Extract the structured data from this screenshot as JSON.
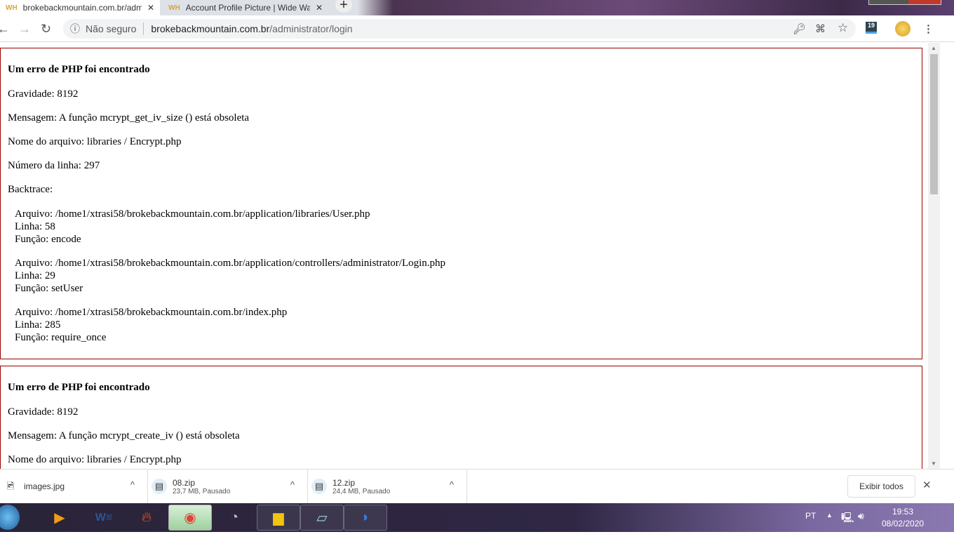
{
  "browser": {
    "tabs": [
      {
        "favicon": "WH",
        "title": "brokebackmountain.com.br/adm",
        "active": true
      },
      {
        "favicon": "WH",
        "title": "Account Profile Picture | Wide Wa",
        "active": false
      }
    ],
    "new_tab": "+",
    "close_glyph": "✕",
    "security_label": "Não seguro",
    "url_host": "brokebackmountain.com.br",
    "url_path": "/administrator/login",
    "calendar_badge": "19"
  },
  "errors": [
    {
      "heading": "Um erro de PHP foi encontrado",
      "severity": "Gravidade: 8192",
      "message": "Mensagem: A função mcrypt_get_iv_size () está obsoleta",
      "filename": "Nome do arquivo: libraries / Encrypt.php",
      "line": "Número da linha: 297",
      "backtrace_label": "Backtrace:",
      "backtrace": [
        {
          "file": "Arquivo: /home1/xtrasi58/brokebackmountain.com.br/application/libraries/User.php",
          "line": "Linha: 58",
          "func": "Função: encode"
        },
        {
          "file": "Arquivo: /home1/xtrasi58/brokebackmountain.com.br/application/controllers/administrator/Login.php",
          "line": "Linha: 29",
          "func": "Função: setUser"
        },
        {
          "file": "Arquivo: /home1/xtrasi58/brokebackmountain.com.br/index.php",
          "line": "Linha: 285",
          "func": "Função: require_once"
        }
      ]
    },
    {
      "heading": "Um erro de PHP foi encontrado",
      "severity": "Gravidade: 8192",
      "message": "Mensagem: A função mcrypt_create_iv () está obsoleta",
      "filename": "Nome do arquivo: libraries / Encrypt.php"
    }
  ],
  "downloads": [
    {
      "name": "images.jpg",
      "status": ""
    },
    {
      "name": "08.zip",
      "status": "23,7 MB, Pausado"
    },
    {
      "name": "12.zip",
      "status": "24,4 MB, Pausado"
    }
  ],
  "show_all": "Exibir todos",
  "taskbar": {
    "lang": "PT",
    "time": "19:53",
    "date": "08/02/2020"
  }
}
